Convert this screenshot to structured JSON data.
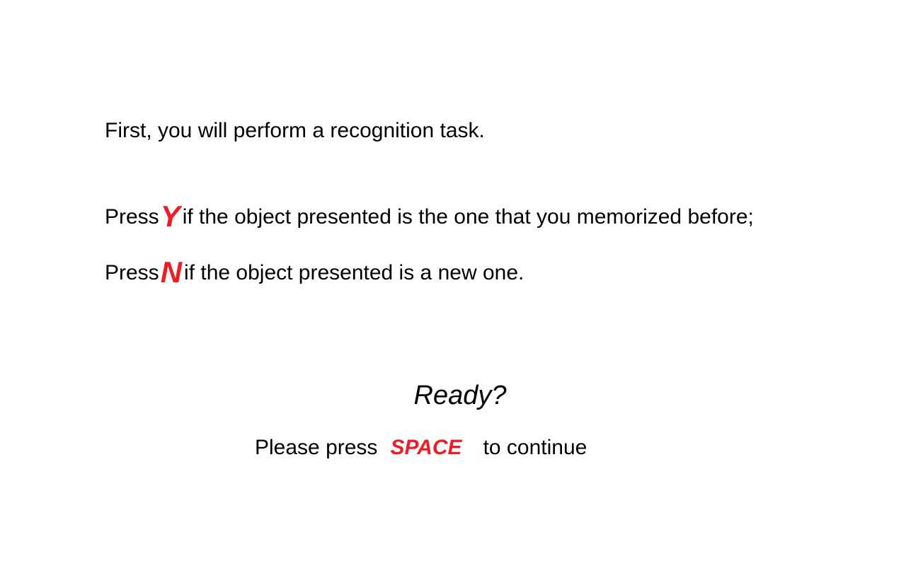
{
  "intro": "First, you will perform a recognition task.",
  "instructions": [
    {
      "prefix": "Press",
      "key": "Y",
      "text": "if the object presented is the one that you memorized before;"
    },
    {
      "prefix": "Press",
      "key": "N",
      "text": "if the object presented is a new one."
    }
  ],
  "ready": "Ready?",
  "continue": {
    "prefix": "Please press",
    "key": "SPACE",
    "suffix": "to continue"
  },
  "colors": {
    "accent": "#ee1c25"
  }
}
